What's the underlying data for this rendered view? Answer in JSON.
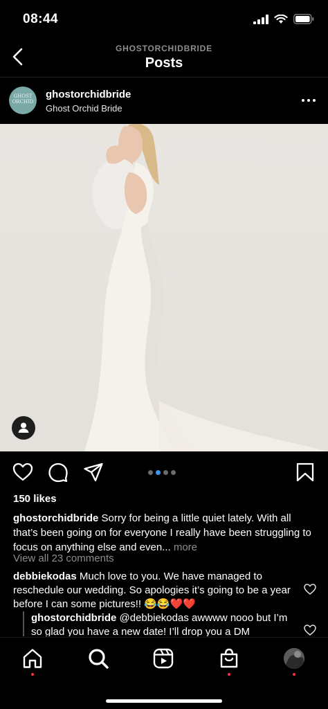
{
  "status_bar": {
    "time": "08:44"
  },
  "header": {
    "account": "GHOSTORCHIDBRIDE",
    "title": "Posts"
  },
  "post": {
    "username": "ghostorchidbride",
    "display_name": "Ghost Orchid Bride",
    "avatar_text_line1": "GHOST",
    "avatar_text_line2": "ORCHID",
    "carousel": {
      "count": 4,
      "active_index": 1
    },
    "likes": "150 likes",
    "caption_user": "ghostorchidbride",
    "caption_text": "Sorry for being a little quiet lately. With all that’s been going on for everyone I really have been struggling to focus on anything else and even...",
    "caption_more": "more",
    "view_comments": "View all 23 comments"
  },
  "comments": [
    {
      "user": "debbiekodas",
      "text": "Much love to you. We have managed to reschedule our wedding. So apologies it’s going to be a year before I can some pictures!! 😂😂❤️❤️"
    }
  ],
  "reply": {
    "user": "ghostorchidbride",
    "text": "@debbiekodas awwww nooo but I’m so glad you have a new date! I’ll drop you a DM"
  },
  "colors": {
    "accent": "#3897f0",
    "notification": "#ff3040",
    "muted": "#8e8e8e"
  },
  "icons": [
    "back-arrow-icon",
    "more-icon",
    "person-tag-icon",
    "heart-icon",
    "comment-icon",
    "share-icon",
    "bookmark-icon",
    "home-icon",
    "search-icon",
    "reels-icon",
    "shop-icon"
  ]
}
